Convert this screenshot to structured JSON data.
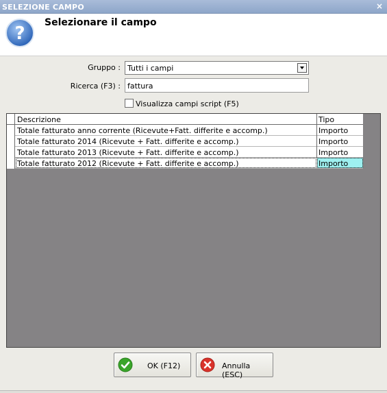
{
  "window": {
    "title": "SELEZIONE CAMPO",
    "close_glyph": "×"
  },
  "header": {
    "title": "Selezionare il campo",
    "icon": "question-icon"
  },
  "form": {
    "gruppo_label": "Gruppo :",
    "gruppo_value": "Tutti i campi",
    "ricerca_label": "Ricerca (F3) :",
    "ricerca_value": "fattura",
    "script_checkbox_label": "Visualizza campi script (F5)",
    "script_checkbox_checked": false
  },
  "grid": {
    "columns": [
      "Descrizione",
      "Tipo"
    ],
    "rows": [
      {
        "descrizione": "Totale fatturato anno corrente (Ricevute+Fatt. differite e accomp.)",
        "tipo": "Importo"
      },
      {
        "descrizione": "Totale fatturato 2014 (Ricevute + Fatt. differite e accomp.)",
        "tipo": "Importo"
      },
      {
        "descrizione": "Totale fatturato 2013 (Ricevute + Fatt. differite e accomp.)",
        "tipo": "Importo"
      },
      {
        "descrizione": "Totale fatturato 2012 (Ricevute + Fatt. differite e accomp.)",
        "tipo": "Importo"
      }
    ],
    "selected_row": 3
  },
  "buttons": {
    "ok_label": "OK (F12)",
    "cancel_label": "Annulla (ESC)"
  },
  "colors": {
    "title_bar": "#8ea6c9",
    "grid_background": "#858385",
    "selected_cell": "#9ef0f0",
    "ok_icon": "#3aa52a",
    "cancel_icon": "#d9332b"
  }
}
